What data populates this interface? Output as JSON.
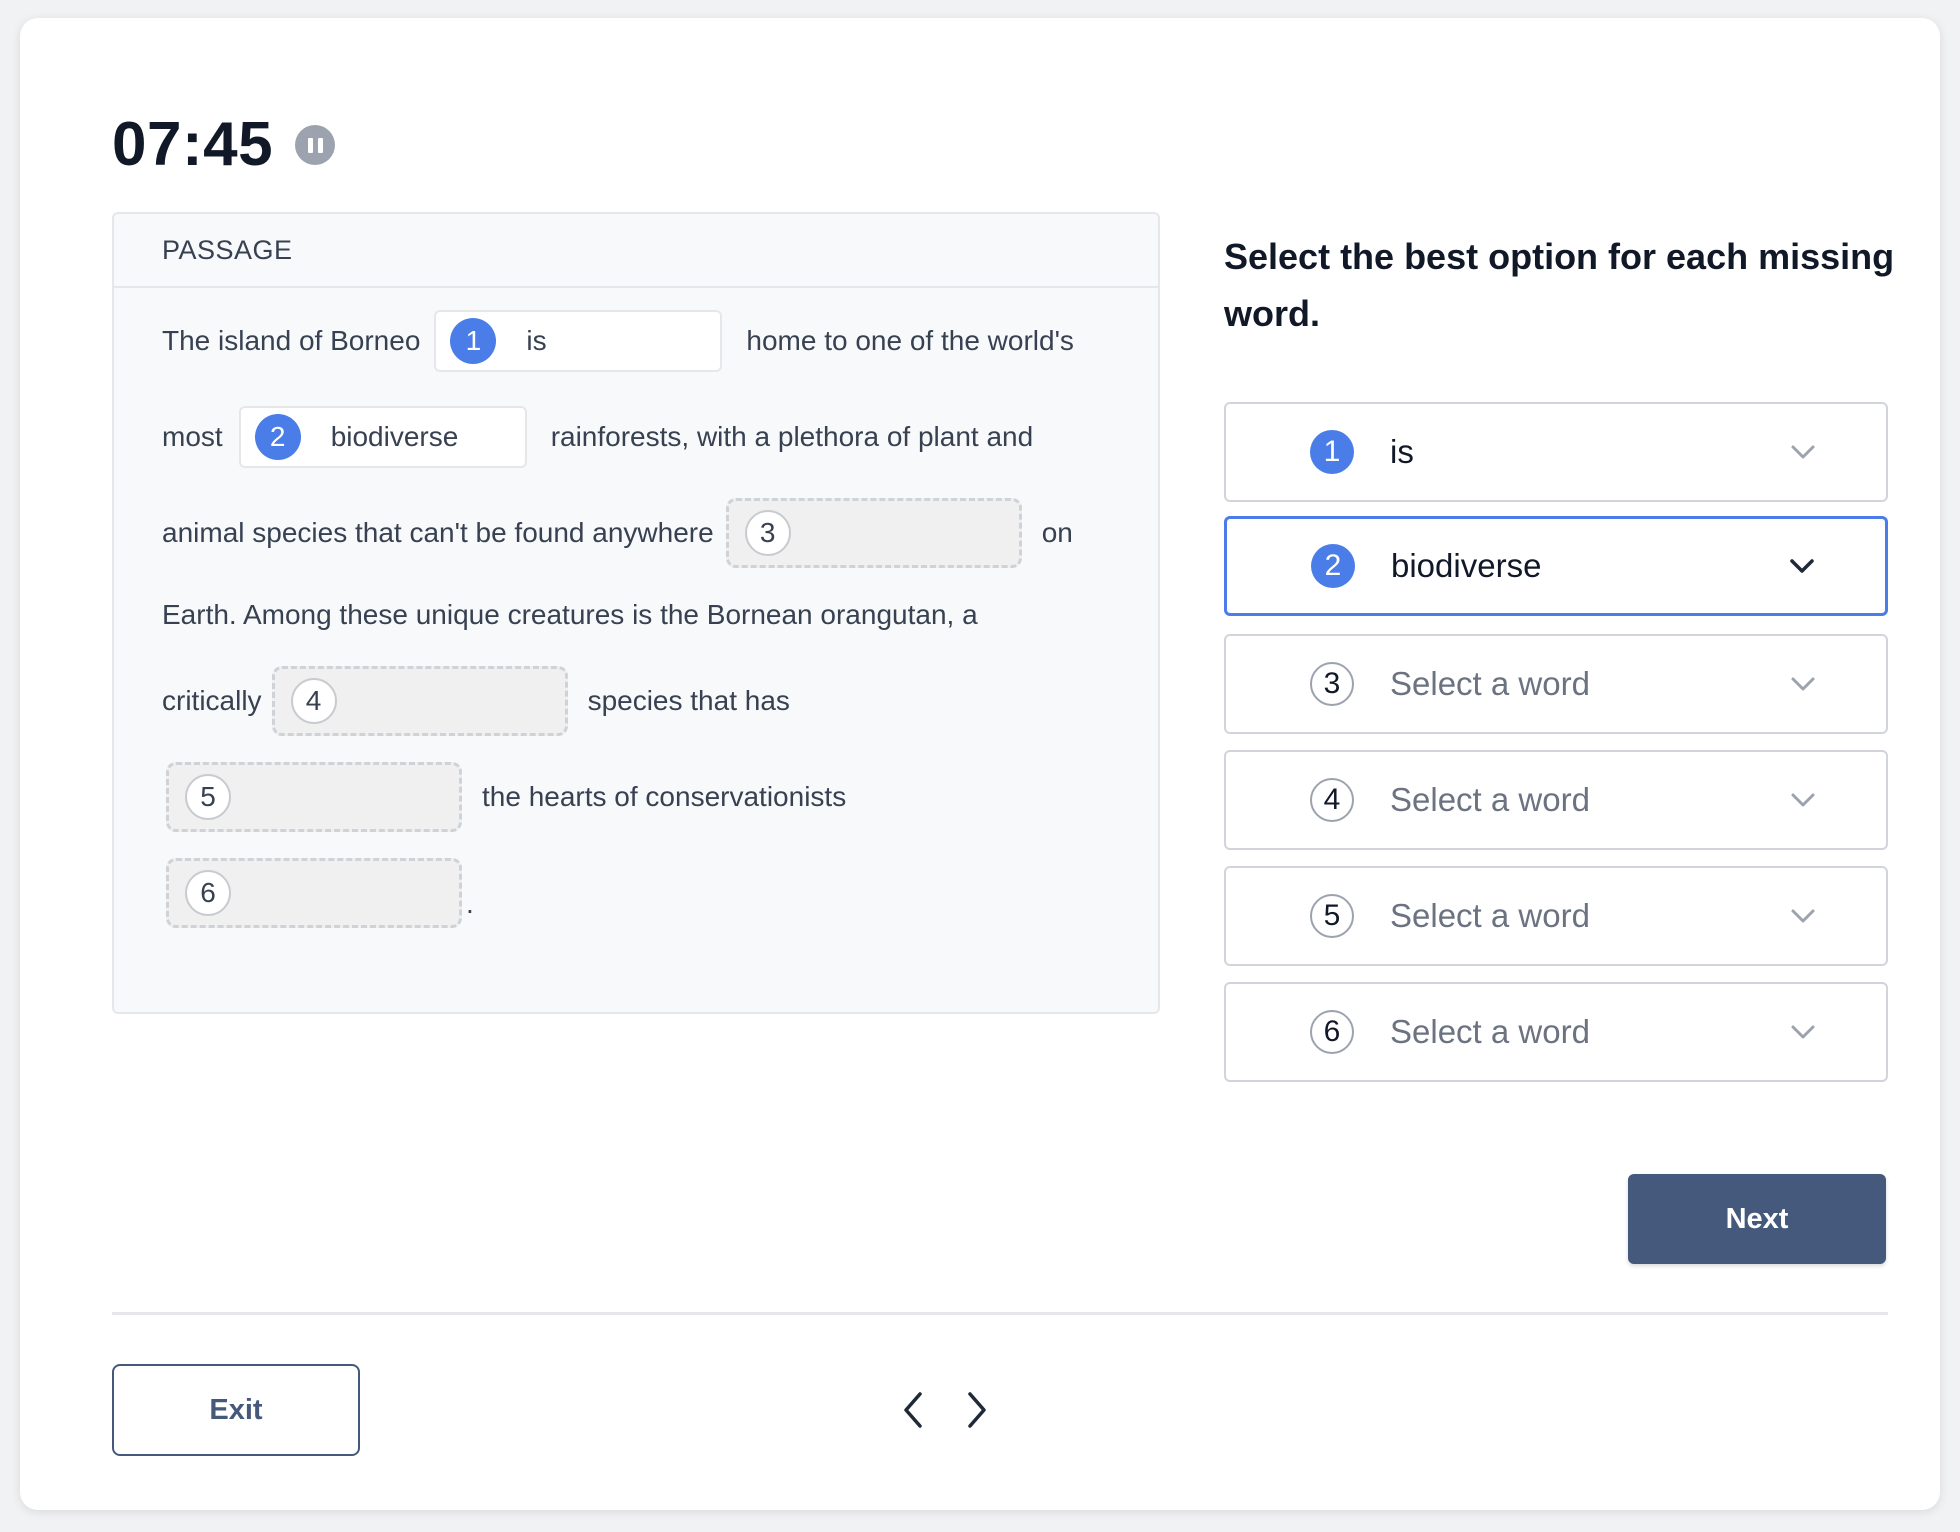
{
  "timer": {
    "value": "07:45",
    "pause_icon": "pause-icon"
  },
  "passage": {
    "header": "PASSAGE",
    "segments": {
      "s1": "The island of Borneo",
      "s2": "home to one of the world's",
      "s3": "most",
      "s4": "rainforests, with a plethora of plant and",
      "s5": "animal species that can't be found anywhere",
      "s6": "on",
      "s7": "Earth. Among these unique creatures is the Bornean orangutan, a",
      "s8": "critically",
      "s9": "species that has",
      "s10": "the hearts of conservationists",
      "s11": "."
    },
    "blanks": [
      {
        "number": "1",
        "word": "is"
      },
      {
        "number": "2",
        "word": "biodiverse"
      },
      {
        "number": "3",
        "word": ""
      },
      {
        "number": "4",
        "word": ""
      },
      {
        "number": "5",
        "word": ""
      },
      {
        "number": "6",
        "word": ""
      }
    ]
  },
  "instruction": "Select the best option for each missing word.",
  "dropdowns": [
    {
      "number": "1",
      "value": "is",
      "placeholder": "",
      "active": false
    },
    {
      "number": "2",
      "value": "biodiverse",
      "placeholder": "",
      "active": true
    },
    {
      "number": "3",
      "value": "",
      "placeholder": "Select a word",
      "active": false
    },
    {
      "number": "4",
      "value": "",
      "placeholder": "Select a word",
      "active": false
    },
    {
      "number": "5",
      "value": "",
      "placeholder": "Select a word",
      "active": false
    },
    {
      "number": "6",
      "value": "",
      "placeholder": "Select a word",
      "active": false
    }
  ],
  "buttons": {
    "next": "Next",
    "exit": "Exit"
  },
  "colors": {
    "accent": "#4a7de8",
    "primary_button": "#44597b"
  },
  "icons": {
    "dropdown": "chevron-down-icon",
    "prev": "chevron-left-icon",
    "next": "chevron-right-icon"
  }
}
